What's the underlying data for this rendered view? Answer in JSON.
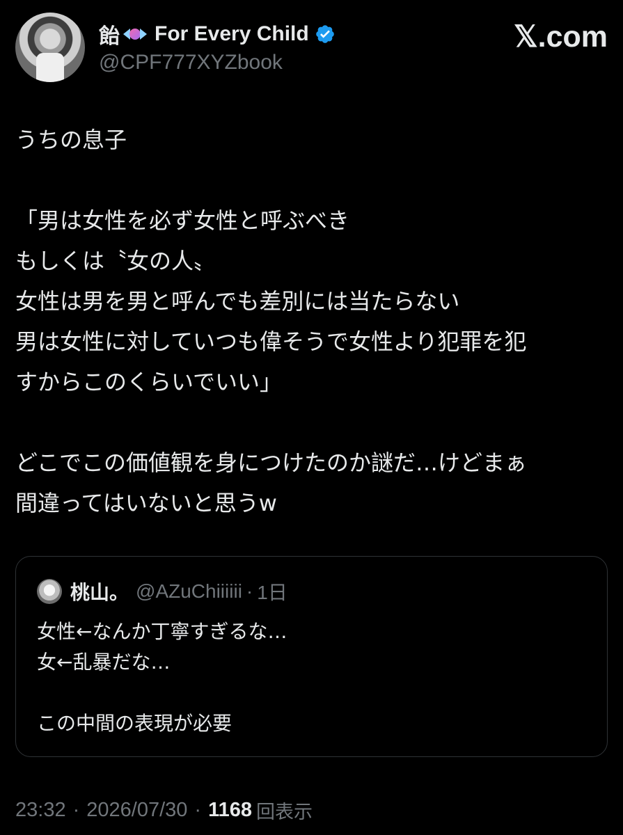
{
  "header": {
    "display_name_prefix": "飴",
    "display_name": "For Every Child",
    "handle": "@CPF777XYZbook",
    "brand": "𝕏.com"
  },
  "tweet": {
    "lines": [
      "うちの息子",
      "",
      "「男は女性を必ず女性と呼ぶべき",
      "もしくは〝女の人〟",
      "女性は男を男と呼んでも差別には当たらない",
      "男は女性に対していつも偉そうで女性より犯罪を犯",
      "すからこのくらいでいい」",
      "",
      "どこでこの価値観を身につけたのか謎だ…けどまぁ",
      "間違ってはいないと思うw"
    ]
  },
  "quote": {
    "name": "桃山。",
    "handle": "@AZuChiiiiii",
    "dot": "·",
    "time": "1日",
    "lines": [
      "女性←なんか丁寧すぎるな…",
      "女←乱暴だな…",
      "",
      "この中間の表現が必要"
    ]
  },
  "meta": {
    "time": "23:32",
    "sep1": "·",
    "date": "2026/07/30",
    "sep2": "·",
    "views": "1168",
    "views_label": "回表示"
  },
  "colors": {
    "background": "#000000",
    "text": "#e7e9ea",
    "secondary": "#71767b",
    "verified": "#1d9bf0",
    "border": "#2f3336"
  },
  "icons": {
    "candy": "candy-icon",
    "verified": "verified-badge-icon"
  }
}
